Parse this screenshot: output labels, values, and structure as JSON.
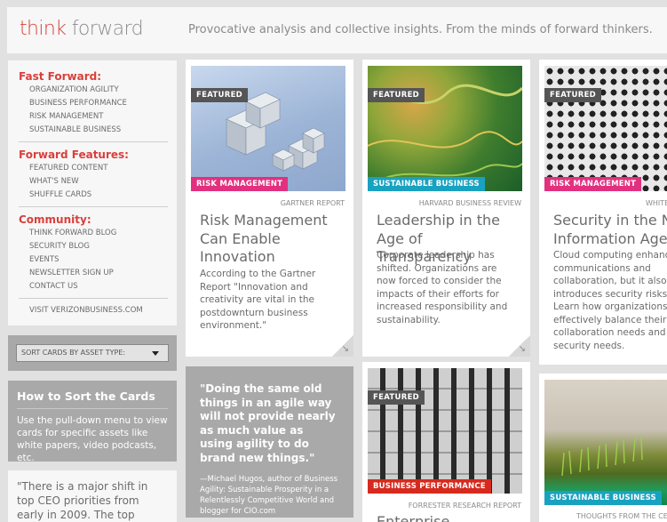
{
  "header": {
    "logo_part1": "think",
    "logo_part2": "forward",
    "tagline": "Provocative analysis and collective insights. From the minds of forward thinkers."
  },
  "sidebar": {
    "fast_forward": {
      "heading": "Fast Forward:",
      "items": [
        "ORGANIZATION AGILITY",
        "BUSINESS PERFORMANCE",
        "RISK MANAGEMENT",
        "SUSTAINABLE BUSINESS"
      ]
    },
    "forward_features": {
      "heading": "Forward Features:",
      "items": [
        "FEATURED CONTENT",
        "WHAT'S NEW",
        "SHUFFLE CARDS"
      ]
    },
    "community": {
      "heading": "Community:",
      "items": [
        "THINK FORWARD BLOG",
        "SECURITY BLOG",
        "EVENTS",
        "NEWSLETTER SIGN UP",
        "CONTACT US"
      ]
    },
    "visit_link": "VISIT VERIZONBUSINESS.COM"
  },
  "sort": {
    "label": "SORT CARDS BY ASSET TYPE:"
  },
  "howto": {
    "title": "How to Sort the Cards",
    "text": "Use the pull-down menu to view cards for specific assets like white papers, video podcasts, etc."
  },
  "left_quote": "\"There is a major shift in top CEO priorities from early in 2009. The top priority,",
  "cards": {
    "c1": {
      "featured": "FEATURED",
      "tag": "RISK MANAGEMENT",
      "source": "GARTNER REPORT",
      "title": "Risk Management Can Enable Innovation",
      "desc": "According to the Gartner Report \"Innovation and creativity are vital in the postdownturn business environment.\""
    },
    "c2": {
      "featured": "FEATURED",
      "tag": "SUSTAINABLE BUSINESS",
      "source": "HARVARD BUSINESS REVIEW",
      "title": "Leadership in the Age of Transparency",
      "desc": "Corporate leadership has shifted. Organizations are now forced to consider the impacts of their efforts for increased responsibility and sustainability."
    },
    "c3": {
      "featured": "FEATURED",
      "tag": "RISK MANAGEMENT",
      "source": "WHITE PAPER",
      "title": "Security in the New Information Age",
      "desc": "Cloud computing enhances communications and collaboration, but it also introduces security risks. Learn how organizations effectively balance their collaboration needs and security needs."
    },
    "c4": {
      "featured": "FEATURED",
      "tag": "BUSINESS PERFORMANCE",
      "source": "FORRESTER RESEARCH REPORT",
      "title": "Enterprise"
    },
    "c5": {
      "tag": "SUSTAINABLE BUSINESS",
      "source": "THOUGHTS FROM THE CEO"
    }
  },
  "quote_card": {
    "text": "\"Doing the same old things in an agile way will not provide nearly as much value as using agility to do brand new things.\"",
    "attribution": "—Michael Hugos, author of Business Agility: Sustainable Prosperity in a Relentlessly Competitive World and blogger for CIO.com"
  },
  "colors": {
    "accent_red": "#d8403c",
    "risk_pink": "#e2307f",
    "sustainable_teal": "#19a2c0",
    "performance_red": "#d62a1e"
  }
}
